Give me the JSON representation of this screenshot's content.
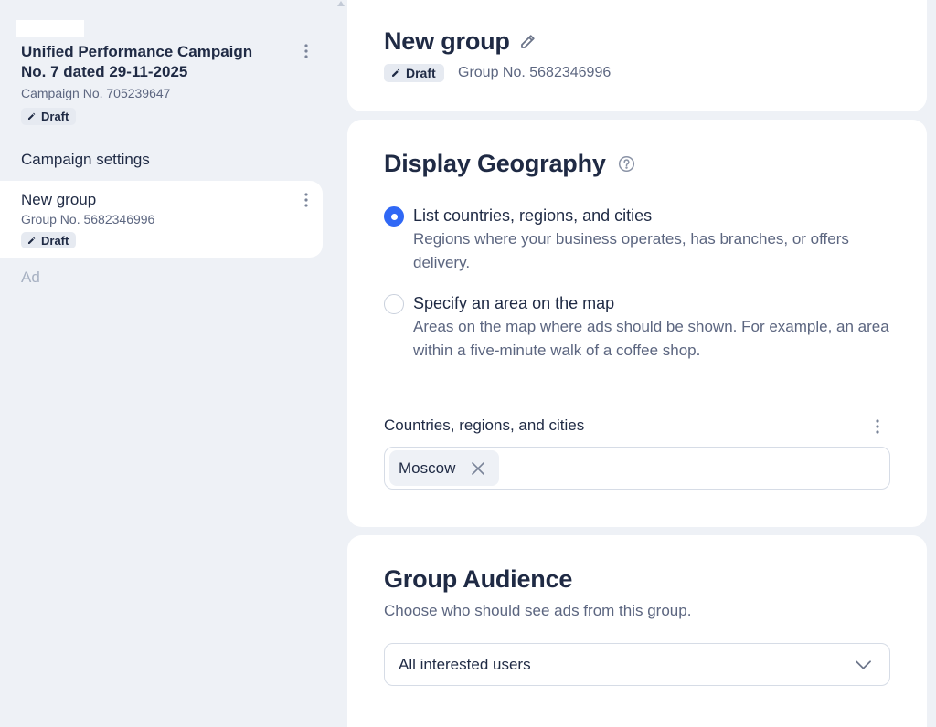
{
  "colors": {
    "background": "#eef1f6",
    "card": "#ffffff",
    "text_primary": "#1f2a44",
    "text_secondary": "#5c6680",
    "text_muted": "#a7b1c2",
    "accent": "#3068f5",
    "badge_bg": "#e6eaf1",
    "border": "#d6dce6"
  },
  "icons": {
    "edit": "pencil-icon",
    "menu": "kebab-icon",
    "help": "help-icon",
    "remove": "close-icon",
    "dropdown": "chevron-down-icon"
  },
  "sidebar": {
    "campaign": {
      "title": "Unified Performance Campaign No. 7 dated 29-11-2025",
      "number": "Campaign No. 705239647",
      "status": "Draft"
    },
    "settings_link": "Campaign settings",
    "group": {
      "title": "New group",
      "number": "Group No. 5682346996",
      "status": "Draft"
    },
    "ad_link": "Ad"
  },
  "header": {
    "title": "New group",
    "status": "Draft",
    "number": "Group No. 5682346996"
  },
  "geography": {
    "title": "Display Geography",
    "options": [
      {
        "label": "List countries, regions, and cities",
        "description": "Regions where your business operates, has branches, or offers delivery.",
        "selected": true
      },
      {
        "label": "Specify an area on the map",
        "description": "Areas on the map where ads should be shown. For example, an area within a five-minute walk of a coffee shop.",
        "selected": false
      }
    ],
    "field_label": "Countries, regions, and cities",
    "selected_locations": [
      "Moscow"
    ]
  },
  "audience": {
    "title": "Group Audience",
    "description": "Choose who should see ads from this group.",
    "selected_value": "All interested users"
  }
}
